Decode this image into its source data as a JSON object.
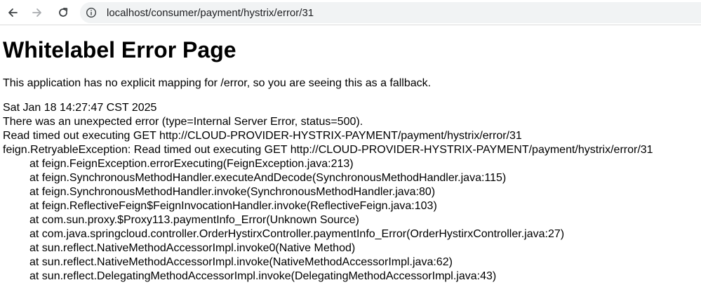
{
  "browser": {
    "url": "localhost/consumer/payment/hystrix/error/31",
    "icons": {
      "back": "back-arrow-icon",
      "forward": "forward-arrow-icon",
      "reload": "reload-icon",
      "site_info": "site-info-icon"
    }
  },
  "page": {
    "title": "Whitelabel Error Page",
    "description": "This application has no explicit mapping for /error, so you are seeing this as a fallback.",
    "timestamp": "Sat Jan 18 14:27:47 CST 2025",
    "error_summary": "There was an unexpected error (type=Internal Server Error, status=500).",
    "message": "Read timed out executing GET http://CLOUD-PROVIDER-HYSTRIX-PAYMENT/payment/hystrix/error/31",
    "exception": "feign.RetryableException: Read timed out executing GET http://CLOUD-PROVIDER-HYSTRIX-PAYMENT/payment/hystrix/error/31",
    "stack": [
      "at feign.FeignException.errorExecuting(FeignException.java:213)",
      "at feign.SynchronousMethodHandler.executeAndDecode(SynchronousMethodHandler.java:115)",
      "at feign.SynchronousMethodHandler.invoke(SynchronousMethodHandler.java:80)",
      "at feign.ReflectiveFeign$FeignInvocationHandler.invoke(ReflectiveFeign.java:103)",
      "at com.sun.proxy.$Proxy113.paymentInfo_Error(Unknown Source)",
      "at com.java.springcloud.controller.OrderHystirxController.paymentInfo_Error(OrderHystirxController.java:27)",
      "at sun.reflect.NativeMethodAccessorImpl.invoke0(Native Method)",
      "at sun.reflect.NativeMethodAccessorImpl.invoke(NativeMethodAccessorImpl.java:62)",
      "at sun.reflect.DelegatingMethodAccessorImpl.invoke(DelegatingMethodAccessorImpl.java:43)"
    ]
  },
  "colors": {
    "icon_active": "#3c4043",
    "icon_disabled": "#a8abaf",
    "address_bar_bg": "#f1f3f4"
  }
}
